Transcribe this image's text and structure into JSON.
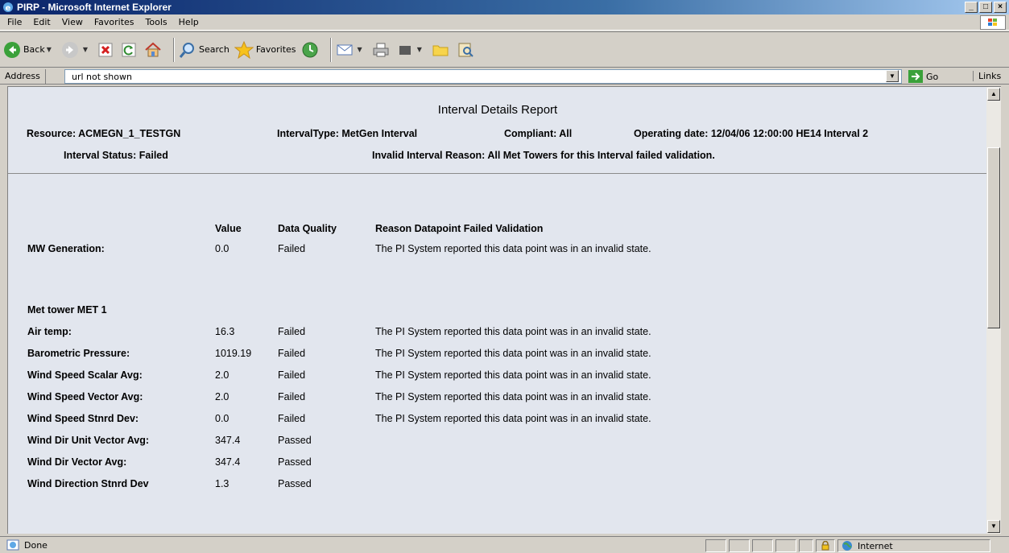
{
  "window": {
    "title": "PIRP - Microsoft Internet Explorer",
    "buttons": [
      "_",
      "□",
      "×"
    ]
  },
  "menu": [
    "File",
    "Edit",
    "View",
    "Favorites",
    "Tools",
    "Help"
  ],
  "toolbar": {
    "back": "Back",
    "search": "Search",
    "favorites": "Favorites"
  },
  "address": {
    "label": "Address",
    "value": "url not shown",
    "go": "Go",
    "links": "Links"
  },
  "report": {
    "title": "Interval Details Report",
    "resource_label": "Resource: ACMEGN_1_TESTGN",
    "interval_type_label": "IntervalType: MetGen Interval",
    "compliant_label": "Compliant: All",
    "operating_date_label": "Operating date: 12/04/06 12:00:00 HE14 Interval 2",
    "interval_status_label": "Interval Status: Failed",
    "invalid_reason_label": "Invalid Interval Reason: All Met Towers for this Interval failed validation.",
    "columns": [
      "Value",
      "Data Quality",
      "Reason Datapoint Failed Validation"
    ],
    "mw_row": {
      "name": "MW Generation:",
      "value": "0.0",
      "quality": "Failed",
      "reason": "The PI System reported this data point was in an invalid state."
    },
    "met_tower_title": "Met tower MET 1",
    "met_rows": [
      {
        "name": "Air temp:",
        "value": "16.3",
        "quality": "Failed",
        "reason": "The PI System reported this data point was in an invalid state."
      },
      {
        "name": "Barometric Pressure:",
        "value": "1019.19",
        "quality": "Failed",
        "reason": "The PI System reported this data point was in an invalid state."
      },
      {
        "name": "Wind Speed Scalar Avg:",
        "value": "2.0",
        "quality": "Failed",
        "reason": "The PI System reported this data point was in an invalid state."
      },
      {
        "name": "Wind Speed Vector Avg:",
        "value": "2.0",
        "quality": "Failed",
        "reason": "The PI System reported this data point was in an invalid state."
      },
      {
        "name": "Wind Speed Stnrd Dev:",
        "value": "0.0",
        "quality": "Failed",
        "reason": "The PI System reported this data point was in an invalid state."
      },
      {
        "name": "Wind Dir Unit Vector Avg:",
        "value": "347.4",
        "quality": "Passed",
        "reason": ""
      },
      {
        "name": "Wind Dir Vector Avg:",
        "value": "347.4",
        "quality": "Passed",
        "reason": ""
      },
      {
        "name": "Wind Direction Stnrd Dev",
        "value": "1.3",
        "quality": "Passed",
        "reason": ""
      }
    ]
  },
  "status": {
    "text": "Done",
    "zone": "Internet"
  },
  "icons": {
    "title": "ie-logo-icon",
    "back": "back-arrow-icon",
    "forward": "forward-arrow-icon",
    "stop": "stop-icon",
    "refresh": "refresh-icon",
    "home": "home-icon",
    "search": "search-icon",
    "favorites": "star-icon",
    "history": "history-icon",
    "mail": "mail-icon",
    "print": "print-icon",
    "edit": "edit-icon",
    "discuss": "folder-icon",
    "research": "research-icon",
    "lock": "lock-icon",
    "internet": "globe-icon"
  }
}
